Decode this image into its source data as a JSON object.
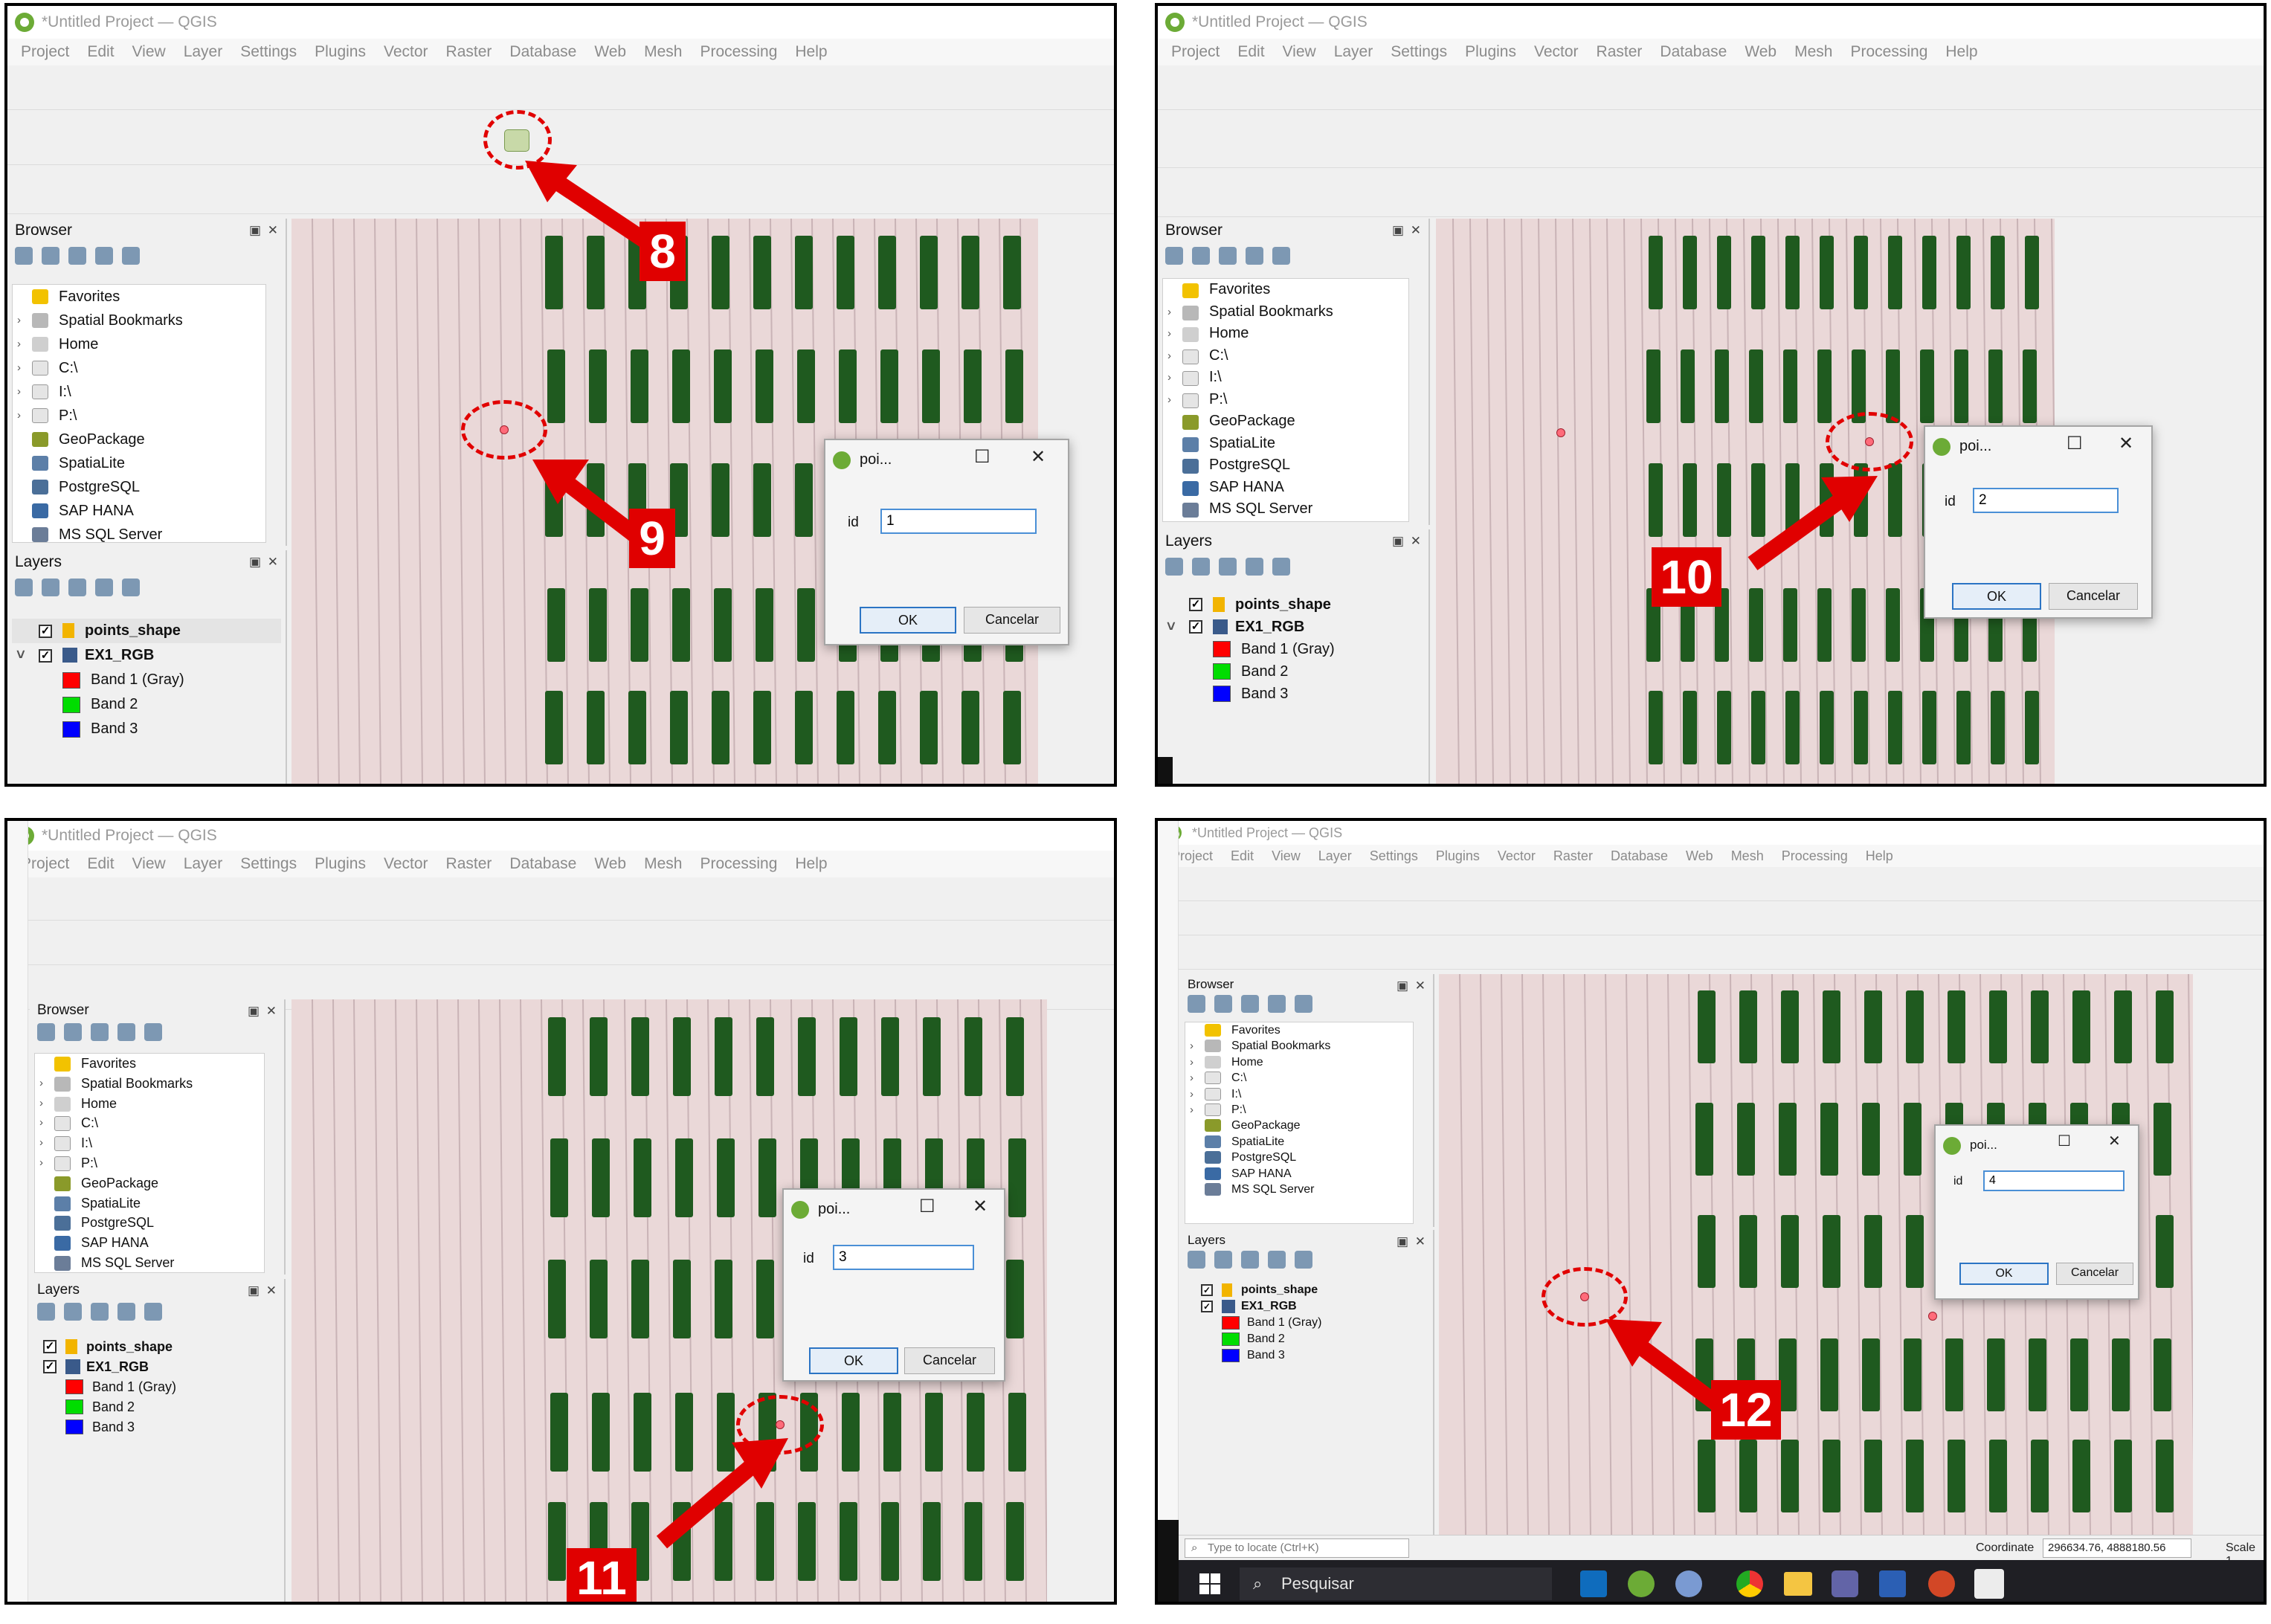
{
  "window_title": "*Untitled Project — QGIS",
  "menu": [
    "Project",
    "Edit",
    "View",
    "Layer",
    "Settings",
    "Plugins",
    "Vector",
    "Raster",
    "Database",
    "Web",
    "Mesh",
    "Processing",
    "Help"
  ],
  "browser": {
    "title": "Browser",
    "items": [
      "Favorites",
      "Spatial Bookmarks",
      "Home",
      "C:\\",
      "I:\\",
      "P:\\",
      "GeoPackage",
      "SpatiaLite",
      "PostgreSQL",
      "SAP HANA",
      "MS SQL Server"
    ]
  },
  "layers": {
    "title": "Layers",
    "items": [
      {
        "name": "points_shape",
        "kind": "vector",
        "color": ""
      },
      {
        "name": "EX1_RGB",
        "kind": "raster",
        "color": ""
      },
      {
        "name": "Band 1 (Gray)",
        "kind": "band",
        "color": "#ff0000"
      },
      {
        "name": "Band 2",
        "kind": "band",
        "color": "#00dd00"
      },
      {
        "name": "Band 3",
        "kind": "band",
        "color": "#0000ff"
      }
    ]
  },
  "dialog": {
    "title": "poi...",
    "field_label": "id",
    "ok": "OK",
    "cancel": "Cancelar"
  },
  "panels": [
    {
      "step": "9",
      "id_value": "1",
      "toolbar_step": "8"
    },
    {
      "step": "10",
      "id_value": "2"
    },
    {
      "step": "11",
      "id_value": "3"
    },
    {
      "step": "12",
      "id_value": "4"
    }
  ],
  "status": {
    "locate_placeholder": "Type to locate (Ctrl+K)",
    "coordinate_label": "Coordinate",
    "coordinate_value": "296634.76, 4888180.56",
    "scale_label": "Scale 1"
  },
  "taskbar": {
    "search": "Pesquisar"
  },
  "colors": {
    "annotation": "#e00000",
    "crop_green": "#1f5a1f",
    "soil": "#ead8d8",
    "point": "#ff6b7a"
  }
}
